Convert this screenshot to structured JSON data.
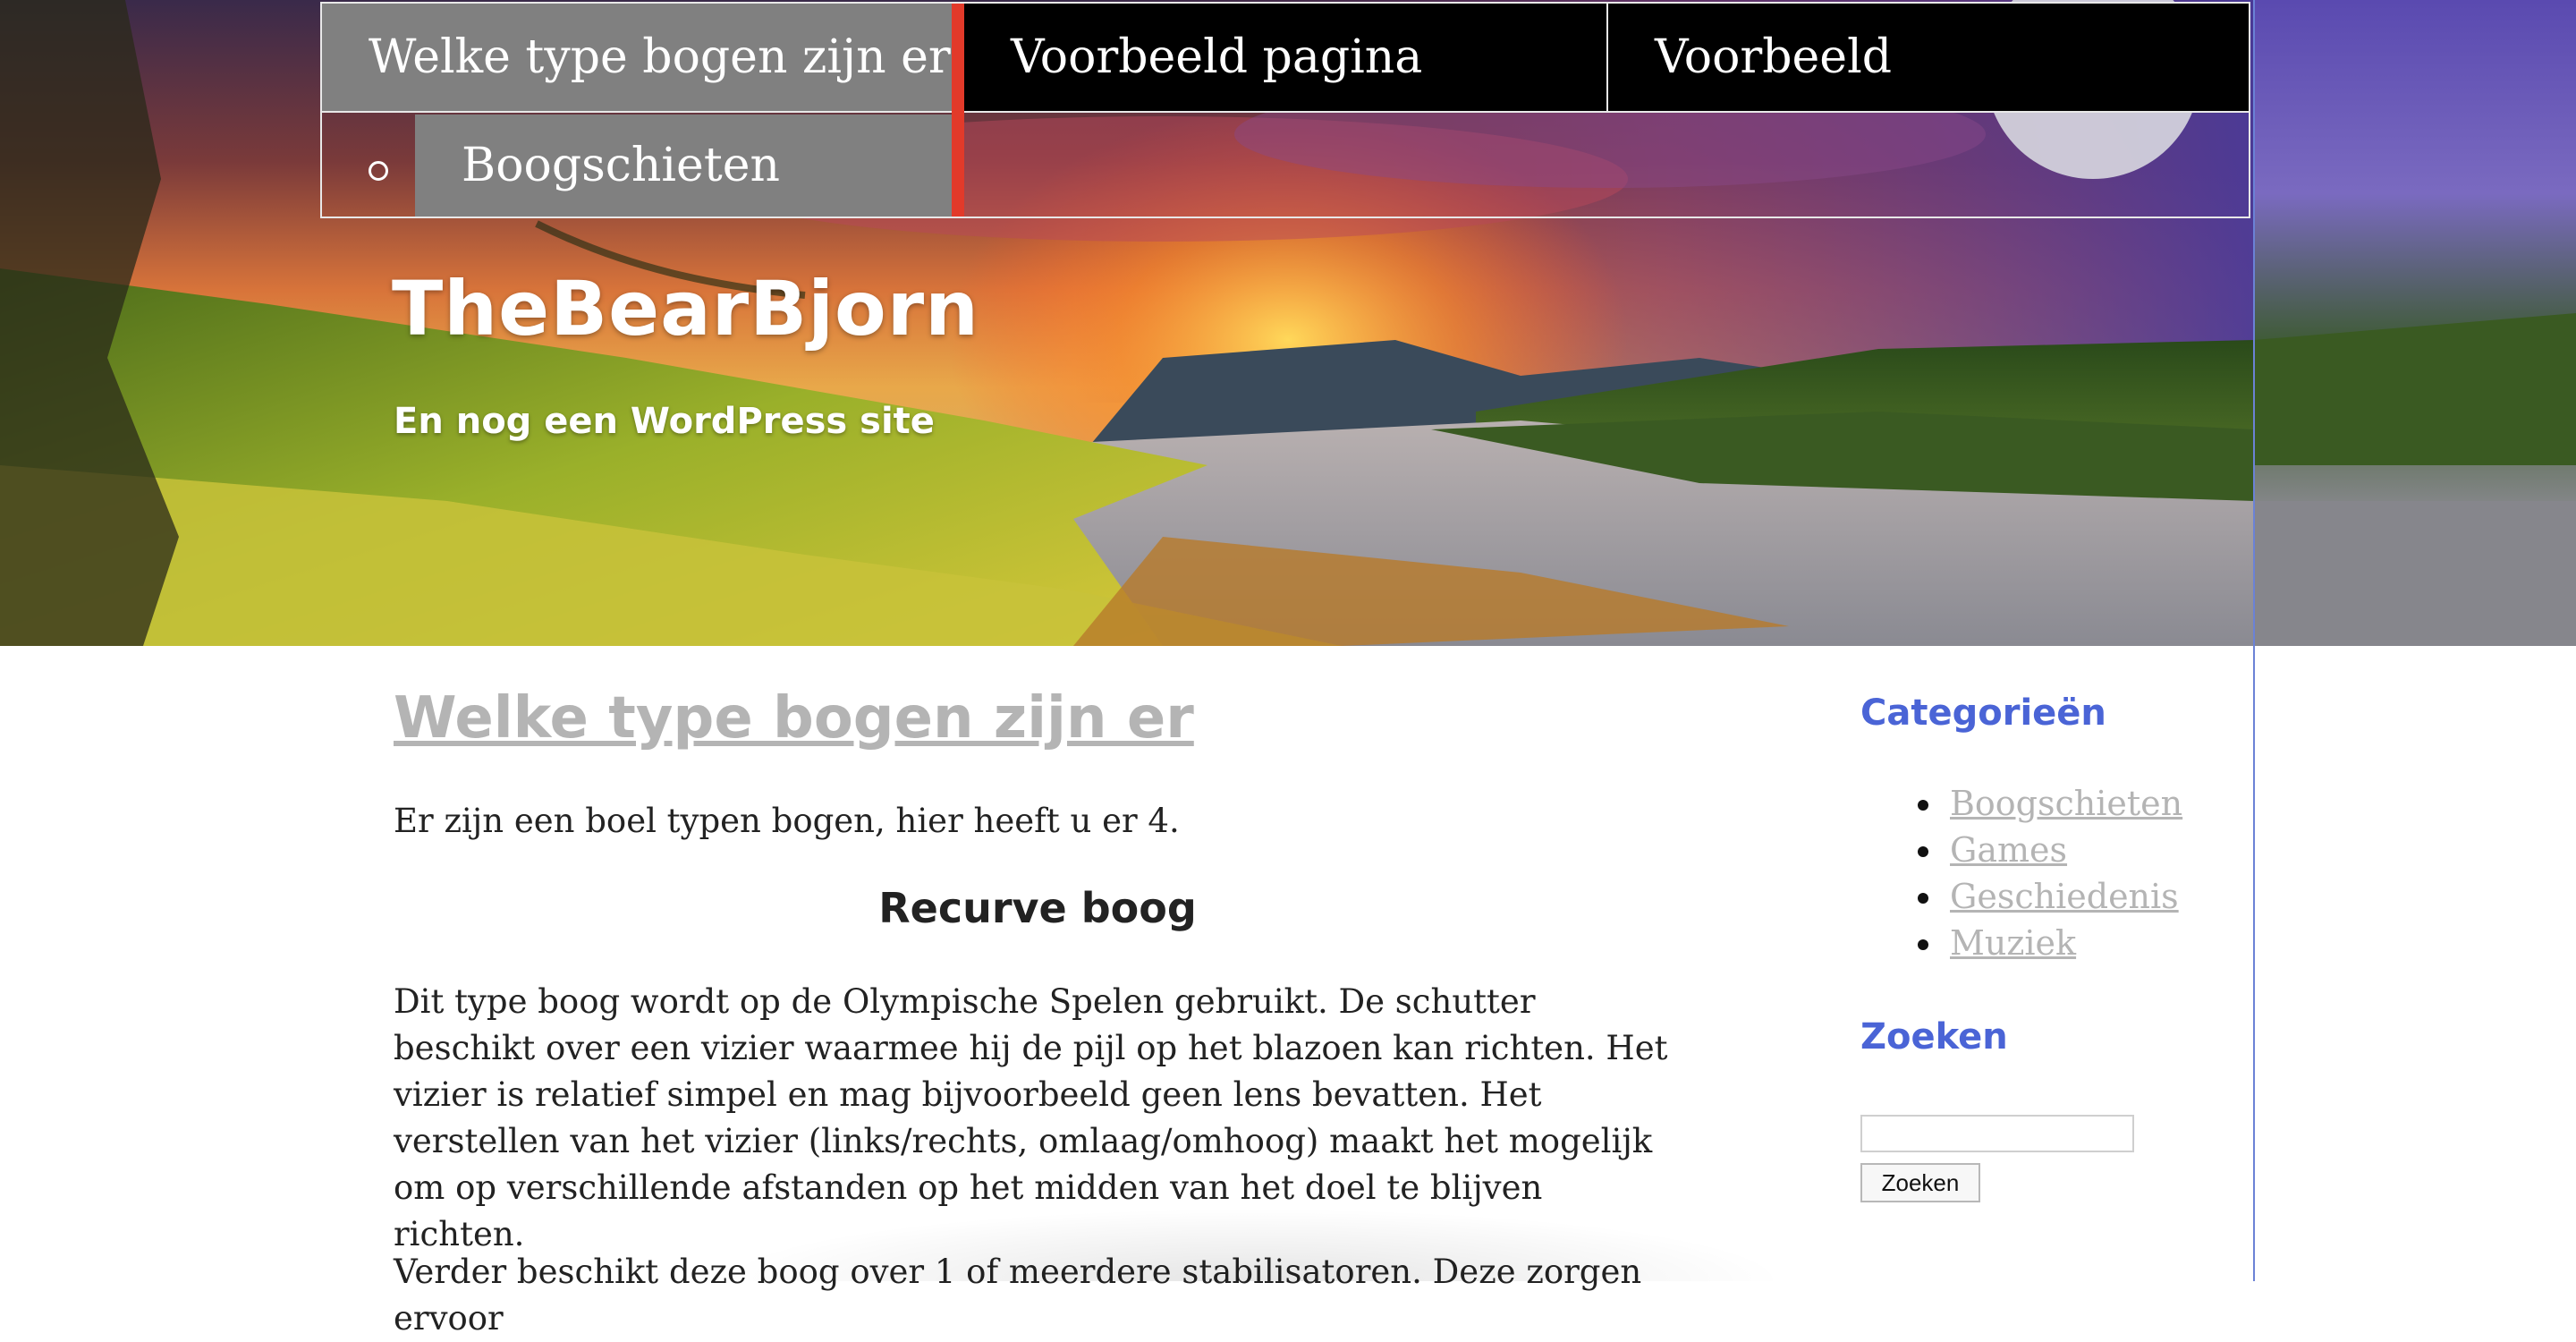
{
  "nav": {
    "items": [
      {
        "label": "Welke type bogen zijn er"
      },
      {
        "label": "Voorbeeld pagina"
      },
      {
        "label": "Voorbeeld"
      }
    ],
    "submenu": [
      {
        "label": "Boogschieten"
      }
    ],
    "colors": {
      "active": "#808080",
      "default": "#000000",
      "accent": "#e23a2a"
    }
  },
  "site": {
    "title": "TheBearBjorn",
    "description": "En nog een WordPress site"
  },
  "post": {
    "title": "Welke type bogen zijn er",
    "intro": "Er zijn een boel typen bogen, hier heeft u er 4.",
    "heading": "Recurve boog",
    "paragraph1": "Dit type boog wordt op de Olympische Spelen gebruikt. De schutter beschikt over een vizier waarmee hij de pijl op het blazoen kan richten. Het vizier is relatief simpel en mag bijvoorbeeld geen lens bevatten. Het verstellen van het vizier (links/rechts, omlaag/omhoog) maakt het mogelijk om op verschillende afstanden op het midden van het doel te blijven richten.",
    "paragraph2": "Verder beschikt deze boog over 1 of meerdere stabilisatoren. Deze zorgen ervoor"
  },
  "sidebar": {
    "categories_title": "Categorieën",
    "categories": [
      {
        "label": "Boogschieten"
      },
      {
        "label": "Games"
      },
      {
        "label": "Geschiedenis"
      },
      {
        "label": "Muziek"
      }
    ],
    "search_title": "Zoeken",
    "search_value": "",
    "search_button": "Zoeken",
    "accent_color": "#4a64d6",
    "link_color": "#b4b4b4"
  }
}
